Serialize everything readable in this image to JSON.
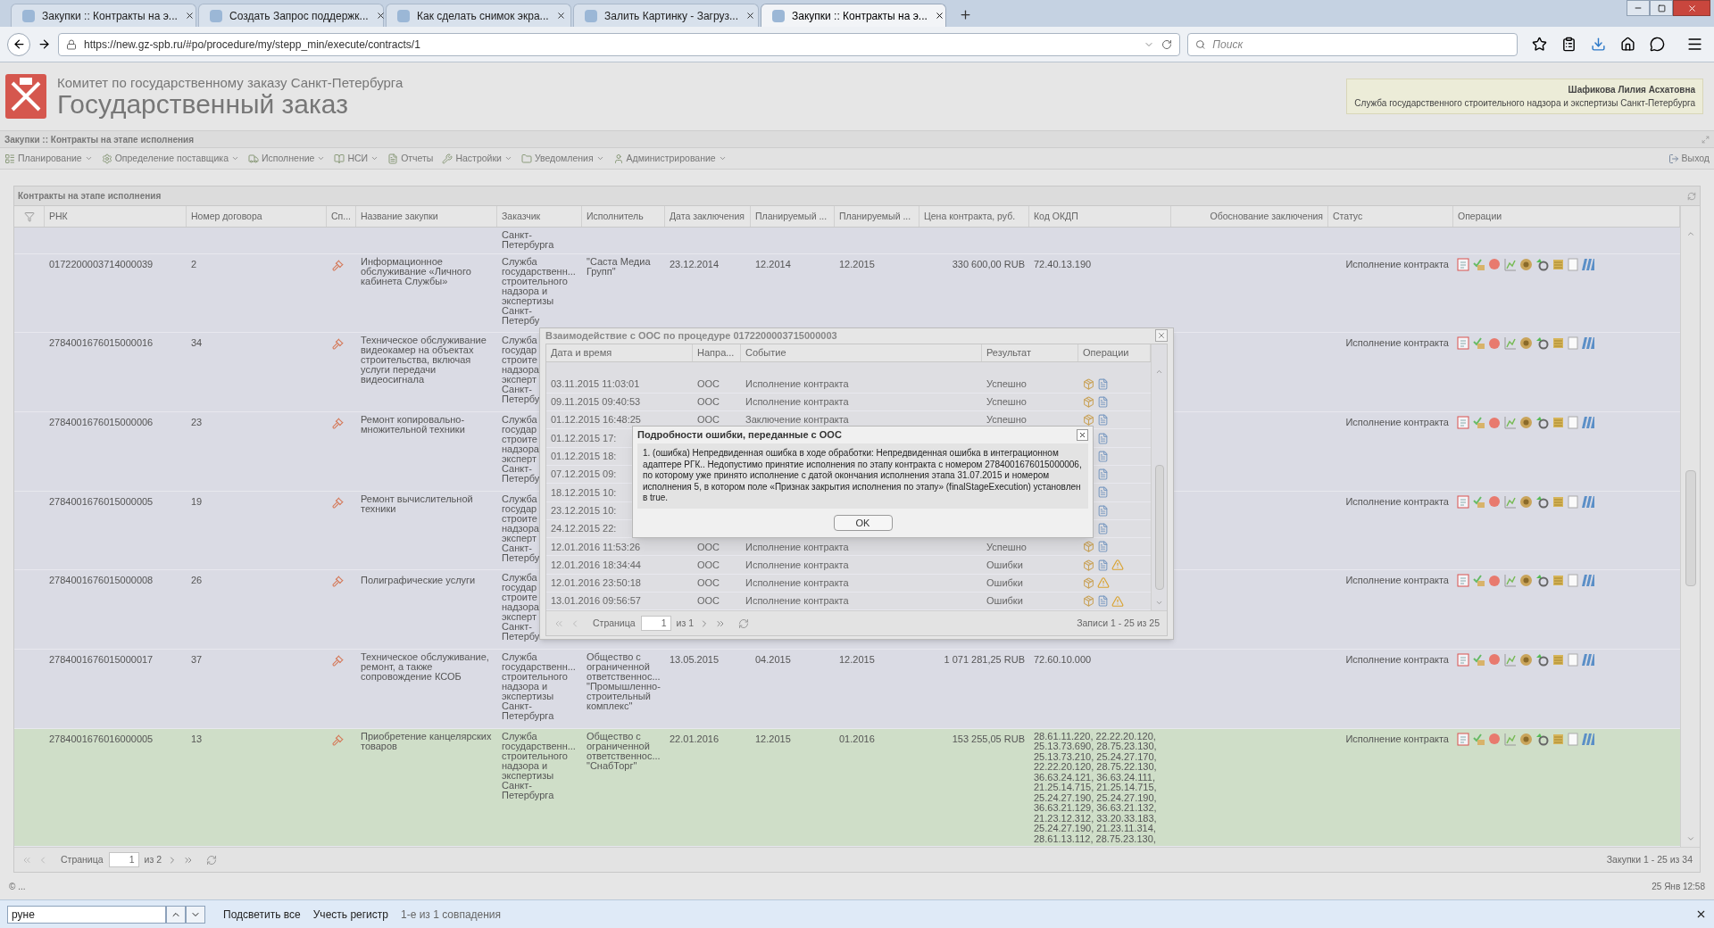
{
  "browser": {
    "tabs": [
      {
        "title": "Закупки :: Контракты на э...",
        "selected": false
      },
      {
        "title": "Создать Запрос поддержк...",
        "selected": false
      },
      {
        "title": "Как сделать снимок экра...",
        "selected": false
      },
      {
        "title": "Залить Картинку - Загруз...",
        "selected": false
      },
      {
        "title": "Закупки :: Контракты на э...",
        "selected": true
      }
    ],
    "url": "https://new.gz-spb.ru/#po/procedure/my/stepp_min/execute/contracts/1",
    "search_placeholder": "Поиск"
  },
  "header": {
    "org": "Комитет по государственному заказу Санкт-Петербурга",
    "title": "Государственный заказ",
    "user": "Шафикова Лилия Асхатовна",
    "user_org": "Служба государственного строительного надзора и экспертизы Санкт-Петербурга"
  },
  "page_title": "Закупки :: Контракты на этапе исполнения",
  "menu": [
    {
      "label": "Планирование",
      "dropdown": true
    },
    {
      "label": "Определение поставщика",
      "dropdown": true
    },
    {
      "label": "Исполнение",
      "dropdown": true
    },
    {
      "label": "НСИ",
      "dropdown": true
    },
    {
      "label": "Отчеты",
      "dropdown": false
    },
    {
      "label": "Настройки",
      "dropdown": true
    },
    {
      "label": "Уведомления",
      "dropdown": true
    },
    {
      "label": "Администрирование",
      "dropdown": true
    }
  ],
  "exit": "Выход",
  "grid": {
    "title": "Контракты на этапе исполнения",
    "columns": [
      "РНК",
      "Номер договора",
      "Сп...",
      "Название закупки",
      "Заказчик",
      "Исполнитель",
      "Дата заключения",
      "Планируемый ...",
      "Планируемый ...",
      "Цена контракта, руб.",
      "Код ОКДП",
      "Обоснование заключения",
      "Статус",
      "Операции"
    ],
    "rows": [
      {
        "customer": "Санкт-\nПетербурга",
        "selected": false
      },
      {
        "rnk": "0172200003714000039",
        "number": "2",
        "name": "Информационное обслуживание «Личного кабинета Службы»",
        "customer": "Служба\nгосударственн...\nстроительного\nнадзора и\nэкспертизы\nСанкт-\nПетербу",
        "executor": "\"Саста Медиа\nГрупп\"",
        "date": "23.12.2014",
        "plan_start": "12.2014",
        "plan_end": "12.2015",
        "price": "330 600,00 RUB",
        "okdp": "72.40.13.190",
        "status": "Исполнение контракта",
        "selected": false
      },
      {
        "rnk": "2784001676015000016",
        "number": "34",
        "name": "Техническое обслуживание видеокамер на объектах строительства, включая услуги передачи видеосигнала",
        "customer": "Служба\nгосудар\nстроите\nнадзора\nэксперт\nСанкт-\nПетербу",
        "status": "Исполнение контракта",
        "selected": false
      },
      {
        "rnk": "2784001676015000006",
        "number": "23",
        "name": "Ремонт копировально-множительной техники",
        "customer": "Служба\nгосудар\nстроите\nнадзора\nэксперт\nСанкт-\nПетербу",
        "status": "Исполнение контракта",
        "selected": false
      },
      {
        "rnk": "2784001676015000005",
        "number": "19",
        "name": "Ремонт вычислительной техники",
        "customer": "Служба\nгосудар\nстроите\nнадзора\nэксперт\nСанкт-\nПетербу",
        "status": "Исполнение контракта",
        "selected": false
      },
      {
        "rnk": "2784001676015000008",
        "number": "26",
        "name": "Полиграфические услуги",
        "customer": "Служба\nгосудар\nстроите\nнадзора\nэксперт\nСанкт-\nПетербу",
        "status": "Исполнение контракта",
        "selected": false
      },
      {
        "rnk": "2784001676015000017",
        "number": "37",
        "name": "Техническое обслуживание, ремонт, а также сопровождение КСОБ",
        "customer": "Служба\nгосударственн...\nстроительного\nнадзора и\nэкспертизы\nСанкт-\nПетербурга",
        "executor": "Общество с\nограниченной\nответственнос...\n\"Промышленно-\nстроительный\nкомплекс\"",
        "date": "13.05.2015",
        "plan_start": "04.2015",
        "plan_end": "12.2015",
        "price": "1 071 281,25 RUB",
        "okdp": "72.60.10.000",
        "status": "Исполнение контракта",
        "selected": false
      },
      {
        "rnk": "2784001676016000005",
        "number": "13",
        "name": "Приобретение канцелярских товаров",
        "customer": "Служба\nгосударственн...\nстроительного\nнадзора и\nэкспертизы\nСанкт-\nПетербурга",
        "executor": "Общество с\nограниченной\nответственнос...\n\"СнабТорг\"",
        "date": "22.01.2016",
        "plan_start": "12.2015",
        "plan_end": "01.2016",
        "price": "153 255,05 RUB",
        "okdp": "28.61.11.220, 22.22.20.120,\n25.13.73.690, 28.75.23.130,\n25.13.73.210, 25.24.27.170,\n22.22.20.120, 28.75.22.130,\n36.63.24.121, 36.63.24.111,\n21.25.14.715, 21.25.14.715,\n25.24.27.190, 25.24.27.190,\n36.63.21.129, 36.63.21.132,\n21.23.12.312, 33.20.33.183,\n25.24.27.190, 21.23.11.314,\n28.61.13.112, 28.75.23.130,",
        "status": "Исполнение контракта",
        "selected": true
      }
    ],
    "pager": {
      "label": "Страница",
      "page": "1",
      "of": "из 2",
      "summary": "Закупки 1 - 25 из 34"
    }
  },
  "status_bar": {
    "left": "© ...",
    "right": "25 Янв 12:58"
  },
  "find_bar": {
    "value": "руне",
    "highlight": "Подсветить все",
    "match_case": "Учесть регистр",
    "result": "1-е из 1 совпадения"
  },
  "dialog": {
    "title": "Взаимодействие с ООС по процедуре 0172200003715000003",
    "columns": [
      "Дата и время",
      "Напра...",
      "Событие",
      "Результат",
      "Операции"
    ],
    "rows": [
      {
        "datetime": "03.11.2015 11:03:01",
        "direction": "ООС",
        "event": "Исполнение контракта",
        "result": "Успешно",
        "document": true,
        "warning": false
      },
      {
        "datetime": "09.11.2015 09:40:53",
        "direction": "ООС",
        "event": "Исполнение контракта",
        "result": "Успешно",
        "document": true,
        "warning": false
      },
      {
        "datetime": "01.12.2015 16:48:25",
        "direction": "ООС",
        "event": "Заключение контракта",
        "result": "Успешно",
        "document": true,
        "warning": false
      },
      {
        "datetime": "01.12.2015 17:",
        "document": true,
        "warning": false
      },
      {
        "datetime": "01.12.2015 18:",
        "document": true,
        "warning": false
      },
      {
        "datetime": "07.12.2015 09:",
        "document": true,
        "warning": false
      },
      {
        "datetime": "18.12.2015 10:",
        "document": true,
        "warning": false
      },
      {
        "datetime": "23.12.2015 10:",
        "document": true,
        "warning": false
      },
      {
        "datetime": "24.12.2015 22:",
        "document": true,
        "warning": false
      },
      {
        "datetime": "12.01.2016 11:53:26",
        "direction": "ООС",
        "event": "Исполнение контракта",
        "result": "Успешно",
        "document": true,
        "warning": false
      },
      {
        "datetime": "12.01.2016 18:34:44",
        "direction": "ООС",
        "event": "Исполнение контракта",
        "result": "Ошибки",
        "document": true,
        "warning": true
      },
      {
        "datetime": "12.01.2016 23:50:18",
        "direction": "ООС",
        "event": "Исполнение контракта",
        "result": "Ошибки",
        "document": false,
        "warning": true
      },
      {
        "datetime": "13.01.2016 09:56:57",
        "direction": "ООС",
        "event": "Исполнение контракта",
        "result": "Ошибки",
        "document": true,
        "warning": true
      }
    ],
    "pager": {
      "label": "Страница",
      "page": "1",
      "of": "из 1",
      "summary": "Записи 1 - 25 из 25"
    }
  },
  "error_dialog": {
    "title": "Подробности ошибки, переданные с ООС",
    "message": "1. (ошибка) Непредвиденная ошибка в ходе обработки: Непредвиденная ошибка в интеграционном адаптере РГК.. Недопустимо принятие исполнения по этапу контракта с номером 2784001676015000006, по которому уже принято исполнение с датой окончания исполнения этапа 31.07.2015 и номером исполнения 5, в котором поле «Признак закрытия исполнения по этапу» (finalStageExecution) установлен в true.",
    "button": "OK"
  }
}
